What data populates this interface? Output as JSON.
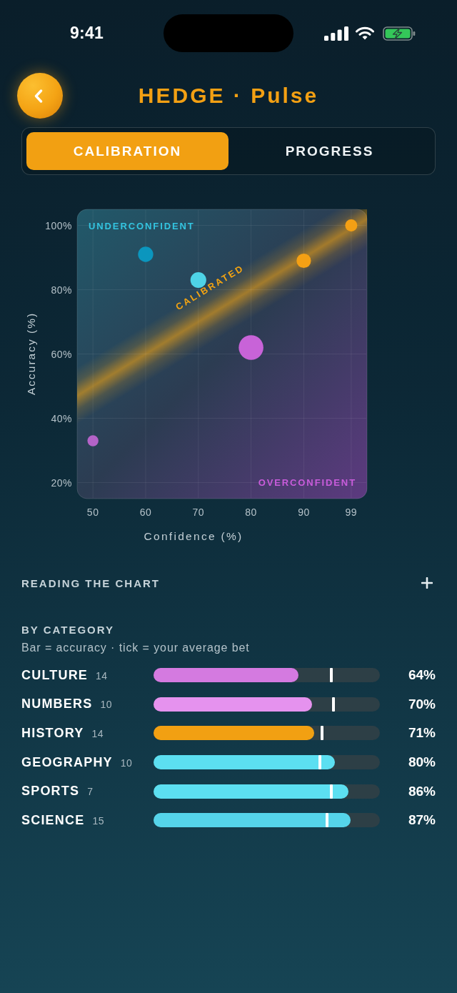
{
  "status_bar": {
    "time": "9:41"
  },
  "header": {
    "title": "HEDGE · Pulse"
  },
  "tabs": [
    {
      "label": "CALIBRATION",
      "selected": true
    },
    {
      "label": "PROGRESS",
      "selected": false
    }
  ],
  "chart": {
    "chart_data": {
      "type": "scatter",
      "xlabel": "Confidence (%)",
      "ylabel": "Accuracy (%)",
      "x": [
        50,
        60,
        70,
        80,
        90,
        99
      ],
      "series": [
        {
          "color": "#b463c8",
          "values": [
            33,
            null,
            null,
            null,
            null,
            null
          ],
          "sizes": [
            0.2,
            null,
            null,
            null,
            null,
            null
          ]
        },
        {
          "color": "#0b96be",
          "values": [
            null,
            91,
            null,
            null,
            null,
            null
          ],
          "sizes": [
            null,
            0.38,
            null,
            null,
            null,
            null
          ]
        },
        {
          "color": "#4ed3e7",
          "values": [
            null,
            null,
            83,
            null,
            null,
            null
          ],
          "sizes": [
            null,
            null,
            0.41,
            null,
            null,
            null
          ]
        },
        {
          "color": "#c863d8",
          "values": [
            null,
            null,
            null,
            62,
            null,
            null
          ],
          "sizes": [
            null,
            null,
            null,
            1,
            null,
            null
          ]
        },
        {
          "color": "#f4a014",
          "values": [
            null,
            null,
            null,
            null,
            89,
            100
          ],
          "sizes": [
            null,
            null,
            null,
            null,
            0.34,
            0.24
          ]
        }
      ],
      "xlim": [
        47,
        102
      ],
      "ylim": [
        15,
        105
      ],
      "xticks": [
        50,
        60,
        70,
        80,
        90,
        99
      ],
      "yticks": [
        {
          "value": 20,
          "label": "20%"
        },
        {
          "value": 40,
          "label": "40%"
        },
        {
          "value": 60,
          "label": "60%"
        },
        {
          "value": 80,
          "label": "80%"
        },
        {
          "value": 100,
          "label": "100%"
        }
      ],
      "grid": true,
      "annotations": [
        "UNDERCONFIDENT",
        "CALIBRATED",
        "OVERCONFIDENT"
      ]
    }
  },
  "reading_the_chart": {
    "title": "READING THE CHART",
    "expanded": false
  },
  "by_category": {
    "title": "BY CATEGORY",
    "subtitle": "Bar = accuracy · tick = your average bet",
    "rows": [
      {
        "name": "CULTURE",
        "count": "14",
        "value": "64%",
        "color": "#d47ae0",
        "level": 0.64,
        "bet": {
          "level": 0.785
        }
      },
      {
        "name": "NUMBERS",
        "count": "10",
        "value": "70%",
        "color": "#e592ee",
        "level": 0.7,
        "bet": {
          "level": 0.795
        }
      },
      {
        "name": "HISTORY",
        "count": "14",
        "value": "71%",
        "color": "#f2a012",
        "level": 0.71,
        "bet": {
          "level": 0.745
        }
      },
      {
        "name": "GEOGRAPHY",
        "count": "10",
        "value": "80%",
        "color": "#5cdff1",
        "level": 0.8,
        "bet": {
          "level": 0.735
        }
      },
      {
        "name": "SPORTS",
        "count": "7",
        "value": "86%",
        "color": "#5cdff1",
        "level": 0.86,
        "bet": {
          "level": 0.785
        }
      },
      {
        "name": "SCIENCE",
        "count": "15",
        "value": "87%",
        "color": "#55d4ea",
        "level": 0.87,
        "bet": {
          "level": 0.765
        }
      }
    ]
  }
}
